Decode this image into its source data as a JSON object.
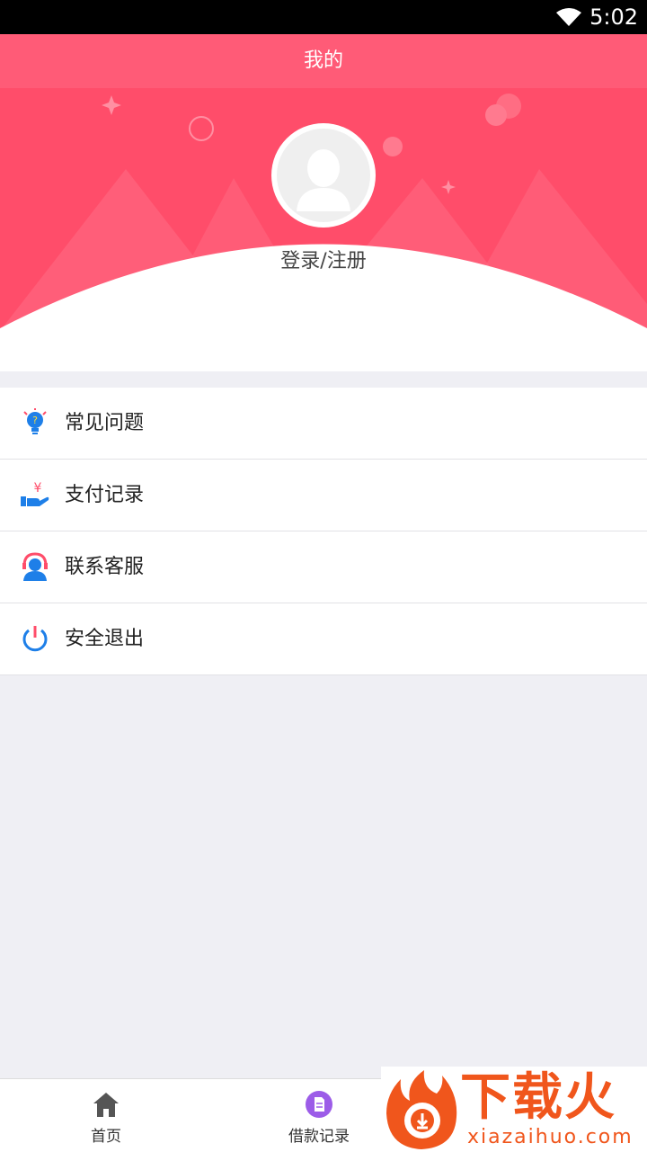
{
  "status_bar": {
    "time": "5:02",
    "wifi_icon": "wifi-icon"
  },
  "header": {
    "title": "我的"
  },
  "profile": {
    "login_label": "登录/注册",
    "avatar_icon": "default-avatar-icon"
  },
  "menu": {
    "items": [
      {
        "label": "常见问题",
        "icon": "faq-bulb-icon"
      },
      {
        "label": "支付记录",
        "icon": "payment-record-icon"
      },
      {
        "label": "联系客服",
        "icon": "customer-service-icon"
      },
      {
        "label": "安全退出",
        "icon": "power-icon"
      }
    ]
  },
  "tabbar": {
    "tabs": [
      {
        "label": "首页",
        "icon": "home-icon"
      },
      {
        "label": "借款记录",
        "icon": "document-icon"
      }
    ]
  },
  "watermark": {
    "main": "下载火",
    "sub": "xiazaihuo.com"
  },
  "colors": {
    "brand": "#ff4d6a",
    "blue": "#1e7fe8",
    "background": "#efeff4",
    "watermark": "#f0561c"
  }
}
